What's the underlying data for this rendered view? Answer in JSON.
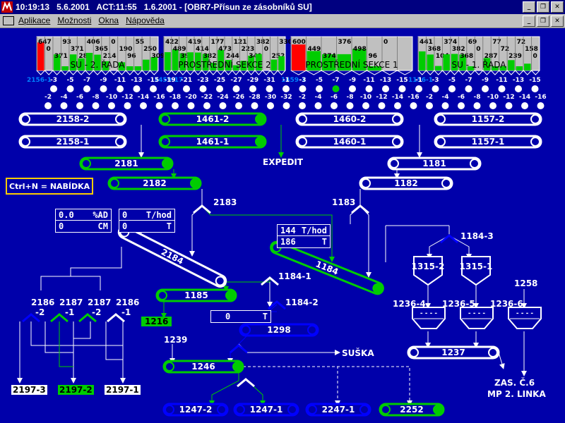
{
  "window": {
    "time": "10:19:13",
    "date": "5.6.2001",
    "act": "ACT:11:55",
    "act_date": "1.6.2001",
    "screen": "[OBR7-Přísun ze zásobníků SU]"
  },
  "menu": [
    "Aplikace",
    "Možnosti",
    "Okna",
    "Nápověda"
  ],
  "bunkers": [
    {
      "name": "SU - 2. ŘADA",
      "values": [
        "647",
        "0",
        "371",
        "93",
        "371",
        "280",
        "406",
        "365",
        "214",
        "0",
        "190",
        "96",
        "55",
        "250",
        "309"
      ],
      "prefix": "2156-1"
    },
    {
      "name": "PROSTŘEDNÍ SEKCE 2",
      "values": [
        "422",
        "489",
        "398",
        "419",
        "414",
        "382",
        "177",
        "473",
        "244",
        "121",
        "223",
        "341",
        "382",
        "0",
        "252",
        "330"
      ],
      "prefix": "1459-17"
    },
    {
      "name": "PROSTŘEDNÍ SEKCE 1",
      "values": [
        "600",
        "449",
        "374",
        "376",
        "498",
        "96",
        "0"
      ],
      "prefix": "1459-1"
    },
    {
      "name": "SU - 1. ŘADA",
      "values": [
        "441",
        "368",
        "104",
        "374",
        "382",
        "368",
        "69",
        "0",
        "287",
        "77",
        "72",
        "239",
        "72",
        "158",
        "0"
      ],
      "prefix": "1156-1"
    }
  ],
  "rows_top": [
    "-3",
    "-5",
    "-7",
    "-9",
    "-11",
    "-13",
    "-15",
    "-19",
    "-21",
    "-23",
    "-25",
    "-27",
    "-29",
    "-31",
    "-1",
    "-3",
    "-5",
    "-7",
    "-9",
    "-11",
    "-13",
    "-15",
    "-1",
    "-3",
    "-5",
    "-7",
    "-9",
    "-11",
    "-13",
    "-15"
  ],
  "rows_bottom": [
    "-2",
    "-4",
    "-6",
    "-8",
    "-10",
    "-12",
    "-14",
    "-16",
    "-18",
    "-20",
    "-22",
    "-24",
    "-26",
    "-28",
    "-30",
    "-32",
    "-2",
    "-4",
    "-6",
    "-8",
    "-10",
    "-12",
    "-14",
    "-16",
    "-2",
    "-4",
    "-6",
    "-8",
    "-10",
    "-12",
    "-14",
    "-16"
  ],
  "conveyors": {
    "c2158_2": "2158-2",
    "c1461_2": "1461-2",
    "c1460_2": "1460-2",
    "c1157_2": "1157-2",
    "c2158_1": "2158-1",
    "c1461_1": "1461-1",
    "c1460_1": "1460-1",
    "c1157_1": "1157-1",
    "c2181": "2181",
    "c1181": "1181",
    "c2182": "2182",
    "c1182": "1182",
    "c2184": "2184",
    "c1184": "1184",
    "c1185": "1185",
    "c1298": "1298",
    "c1246": "1246",
    "c1237": "1237",
    "c1247_2": "1247-2",
    "c1247_1": "1247-1",
    "c2247_1": "2247-1",
    "c2252": "2252"
  },
  "labels": {
    "expedit": "EXPEDIT",
    "ctrl_n": "Ctrl+N = NABÍDKA",
    "l2183": "2183",
    "l1183": "1183",
    "l1184_3": "1184-3",
    "l1184_1": "1184-1",
    "l1184_2": "1184-2",
    "l1239": "1239",
    "l1258": "1258",
    "l1236_4": "1236-4",
    "l1236_5": "1236-5",
    "l1236_6": "1236-6",
    "l1315_2": "1315-2",
    "l1315_1": "1315-1",
    "susha": "SUŠKA",
    "zas": "ZAS. Č.6",
    "mp": "MP 2. LINKA",
    "l2186_2a": "2186",
    "l2186_2b": "-2",
    "l2187_1a": "2187",
    "l2187_1b": "-1",
    "l2187_2a": "2187",
    "l2187_2b": "-2",
    "l2186_1a": "2186",
    "l2186_1b": "-1",
    "l1216": "1216",
    "l2197_3": "2197-3",
    "l2197_2": "2197-2",
    "l2197_1": "2197-1"
  },
  "readouts": {
    "ad_val": "0.0",
    "ad_unit": "%AD",
    "cm_val": "0",
    "cm_unit": "CM",
    "th1_val": "0",
    "th1_unit": "T/hod",
    "t1_val": "0",
    "t1_unit": "T",
    "th2_val": "144",
    "th2_unit": "T/hod",
    "t2_val": "186",
    "t2_unit": "T",
    "t3_val": "0",
    "t3_unit": "T"
  },
  "colors": {
    "bg": "#0000aa",
    "green": "#00cc00",
    "blue": "#0000ff",
    "white": "#ffffff",
    "red": "#ff0000"
  }
}
